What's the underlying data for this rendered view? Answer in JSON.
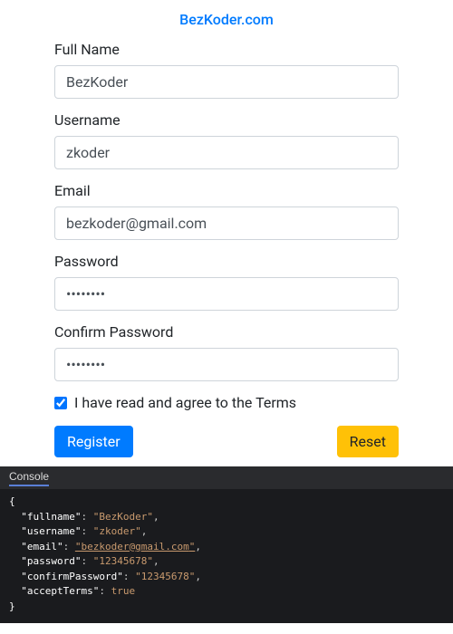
{
  "brand": "BezKoder.com",
  "form": {
    "fullname": {
      "label": "Full Name",
      "value": "BezKoder"
    },
    "username": {
      "label": "Username",
      "value": "zkoder"
    },
    "email": {
      "label": "Email",
      "value": "bezkoder@gmail.com"
    },
    "password": {
      "label": "Password",
      "value": "12345678"
    },
    "confirm": {
      "label": "Confirm Password",
      "value": "12345678"
    },
    "terms": {
      "label": "I have read and agree to the Terms",
      "checked": true
    },
    "register_label": "Register",
    "reset_label": "Reset"
  },
  "console": {
    "title": "Console",
    "output": {
      "fullname": "BezKoder",
      "username": "zkoder",
      "email": "bezkoder@gmail.com",
      "password": "12345678",
      "confirmPassword": "12345678",
      "acceptTerms": true
    }
  }
}
